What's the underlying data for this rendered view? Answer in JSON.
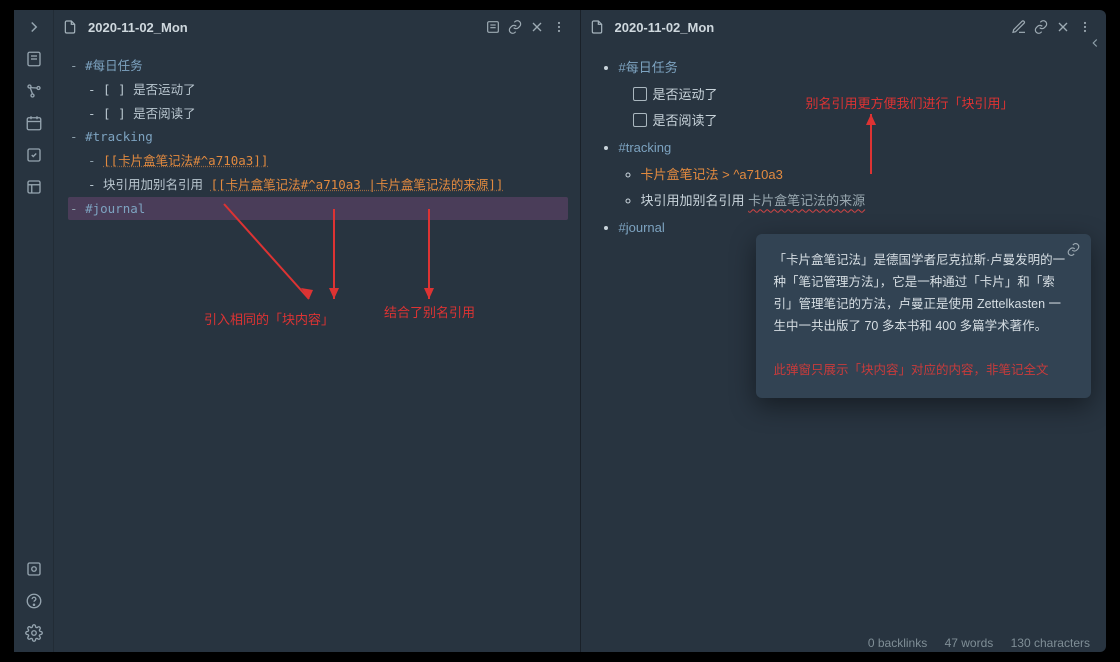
{
  "header": {
    "title_left": "2020-11-02_Mon",
    "title_right": "2020-11-02_Mon"
  },
  "editor": {
    "lines": [
      {
        "cls": "",
        "text": "- ",
        "tag": "#每日任务"
      },
      {
        "cls": "indent1",
        "text": "- [ ] 是否运动了"
      },
      {
        "cls": "indent1",
        "text": "- [ ] 是否阅读了"
      },
      {
        "cls": "",
        "text": "- ",
        "tag": "#tracking"
      },
      {
        "cls": "indent1",
        "link": "[[卡片盒笔记法#^a710a3]]",
        "pre": "- "
      },
      {
        "cls": "indent1",
        "pre": "- 块引用加别名引用 ",
        "link": "[[卡片盒笔记法#^a710a3 |卡片盒笔记法的来源]]"
      },
      {
        "cls": "line-hl",
        "text": "- ",
        "tag": "#journal"
      }
    ]
  },
  "preview": {
    "items": [
      {
        "tag": "#每日任务",
        "children": [
          {
            "checkbox": true,
            "label": "是否运动了"
          },
          {
            "checkbox": true,
            "label": "是否阅读了"
          }
        ]
      },
      {
        "tag": "#tracking",
        "children": [
          {
            "link_main": "卡片盒笔记法 > ",
            "link_suffix": "^a710a3"
          },
          {
            "plain_pre": "块引用加别名引用 ",
            "alias": "卡片盒笔记法的来源"
          }
        ]
      },
      {
        "tag": "#journal"
      }
    ]
  },
  "popover": {
    "text": "「卡片盒笔记法」是德国学者尼克拉斯·卢曼发明的一种「笔记管理方法」，它是一种通过「卡片」和「索引」管理笔记的方法，卢曼正是使用 Zettelkasten 一生中一共出版了 70 多本书和 400 多篇学术著作。",
    "note": "此弹窗只展示「块内容」对应的内容，非笔记全文"
  },
  "annotations": {
    "left1": "引入相同的「块内容」",
    "left2": "结合了别名引用",
    "right1": "别名引用更方便我们进行「块引用」"
  },
  "status": {
    "backlinks": "0 backlinks",
    "words": "47 words",
    "chars": "130 characters"
  }
}
